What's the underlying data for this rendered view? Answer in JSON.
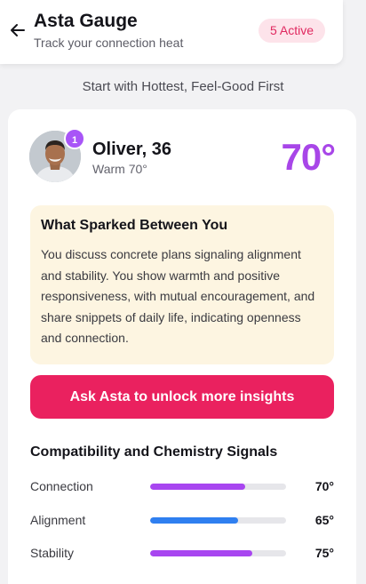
{
  "header": {
    "title": "Asta Gauge",
    "subtitle": "Track your connection heat",
    "active_badge": "5 Active"
  },
  "section_caption": "Start with Hottest, Feel-Good First",
  "match": {
    "rank": "1",
    "name": "Oliver, 36",
    "status": "Warm 70°",
    "score": "70°",
    "spark": {
      "title": "What Sparked Between You",
      "text": "You discuss concrete plans signaling alignment and stability. You show warmth and positive responsiveness, with mutual encouragement, and share snippets of daily life, indicating openness and connection."
    },
    "unlock_button": "Ask Asta to unlock more insights"
  },
  "signals": {
    "title": "Compatibility and Chemistry Signals",
    "items": [
      {
        "label": "Connection",
        "value": "70°",
        "level": 0.7,
        "color": "#a846f0"
      },
      {
        "label": "Alignment",
        "value": "65°",
        "level": 0.65,
        "color": "#2f7ff0"
      },
      {
        "label": "Stability",
        "value": "75°",
        "level": 0.75,
        "color": "#a846f0"
      }
    ]
  },
  "colors": {
    "accent": "#ea215f",
    "score": "#a846e8",
    "badge_bg": "#fde3ea",
    "spark_bg": "#fdf5e1"
  },
  "icons": [
    "arrow-left-icon"
  ]
}
